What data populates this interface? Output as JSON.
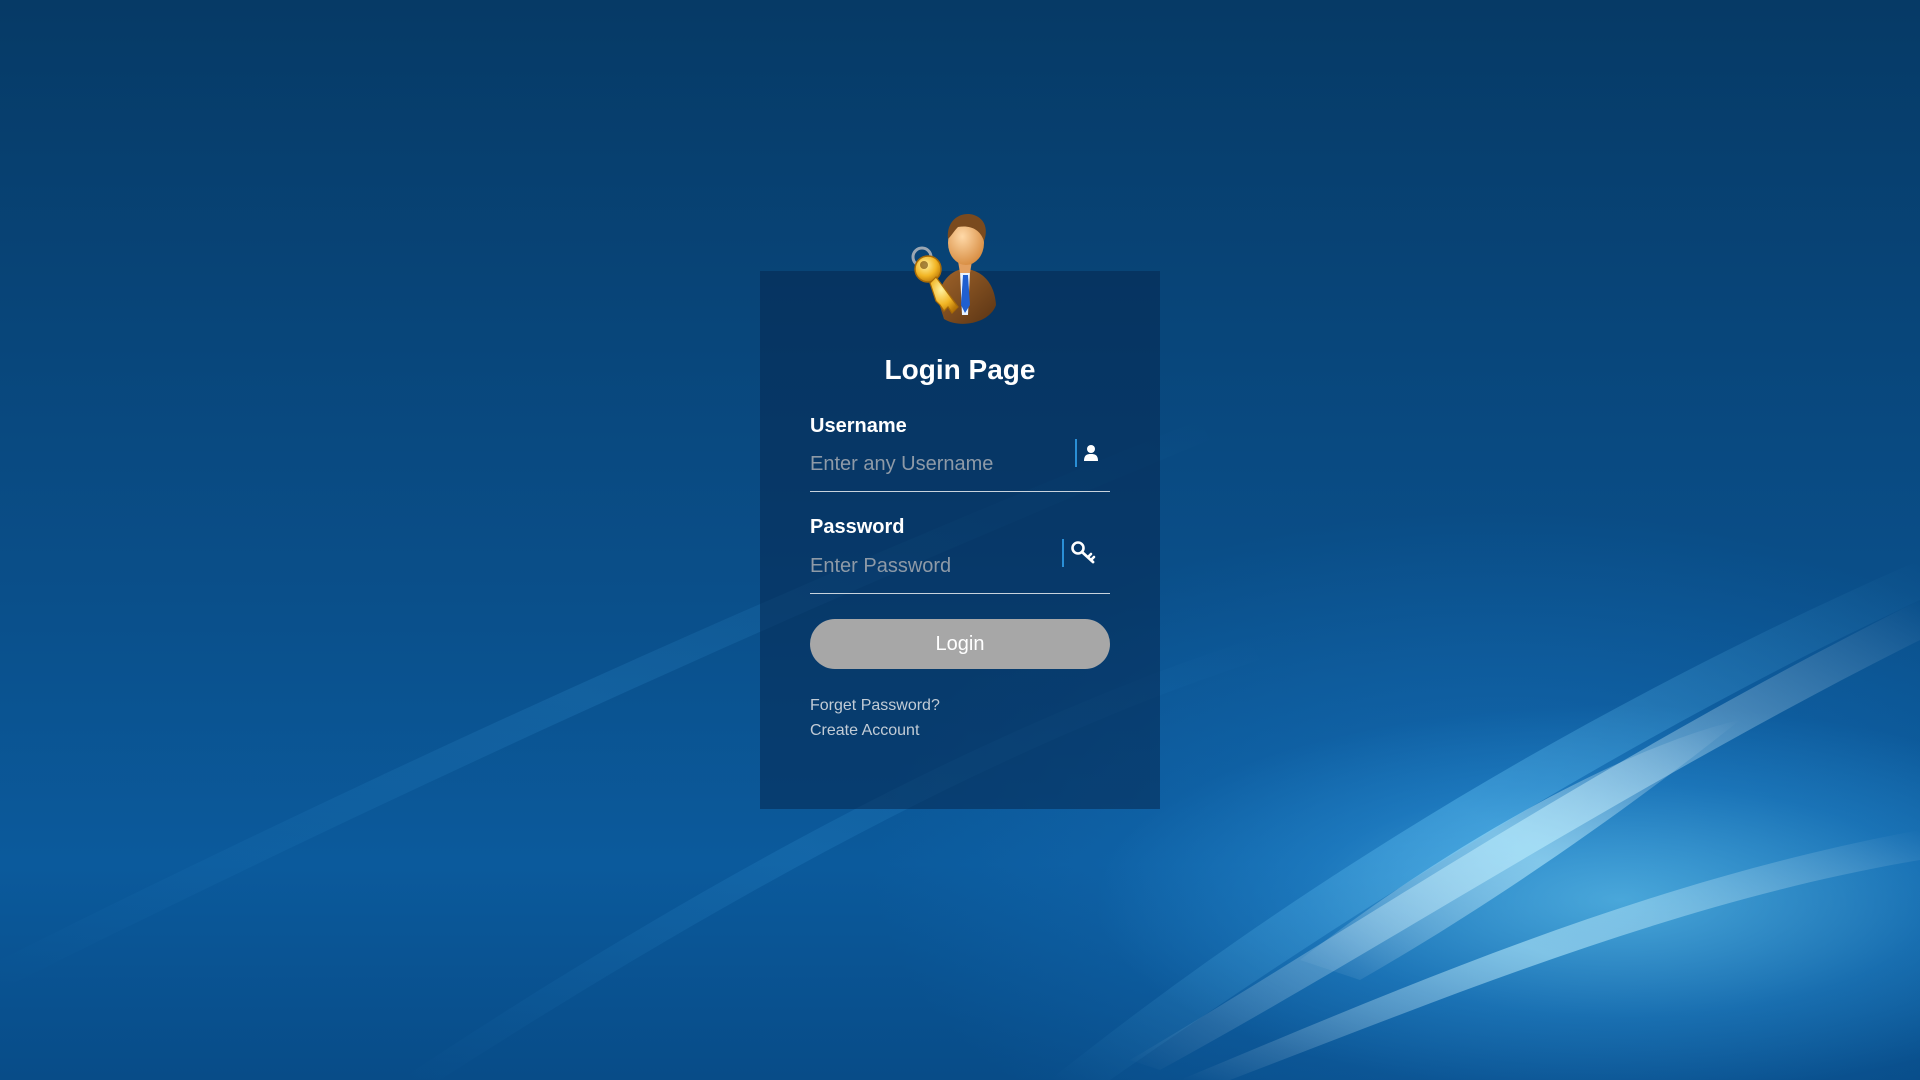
{
  "page": {
    "title": "Login Page"
  },
  "form": {
    "username": {
      "label": "Username",
      "placeholder": "Enter any Username",
      "value": ""
    },
    "password": {
      "label": "Password",
      "placeholder": "Enter Password",
      "value": ""
    },
    "login_label": "Login"
  },
  "links": {
    "forgot_password": "Forget Password?",
    "create_account": "Create Account"
  },
  "icons": {
    "avatar": "businessman-with-key-icon",
    "username": "user-icon",
    "password": "key-icon"
  },
  "colors": {
    "background": "#0a4f8a",
    "panel": "#052850",
    "button": "#a7a7a7",
    "text": "#ffffff",
    "placeholder": "#8e9aa7",
    "accent": "#2a8fd6"
  }
}
